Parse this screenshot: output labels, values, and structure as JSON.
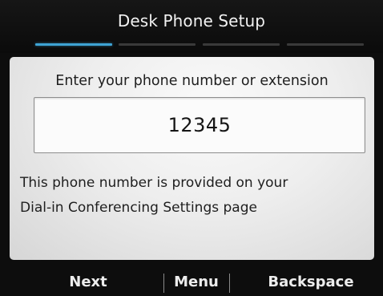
{
  "header": {
    "title": "Desk Phone Setup",
    "progress": {
      "total_steps": 4,
      "current_step": 1
    }
  },
  "form": {
    "prompt": "Enter your phone number or extension",
    "input_value": "12345",
    "help_line_1": "This phone number is provided on your",
    "help_line_2": "Dial-in Conferencing Settings page"
  },
  "softkeys": {
    "next": "Next",
    "menu": "Menu",
    "backspace": "Backspace"
  },
  "colors": {
    "accent": "#3ea3d4",
    "background": "#0d0d0d"
  }
}
